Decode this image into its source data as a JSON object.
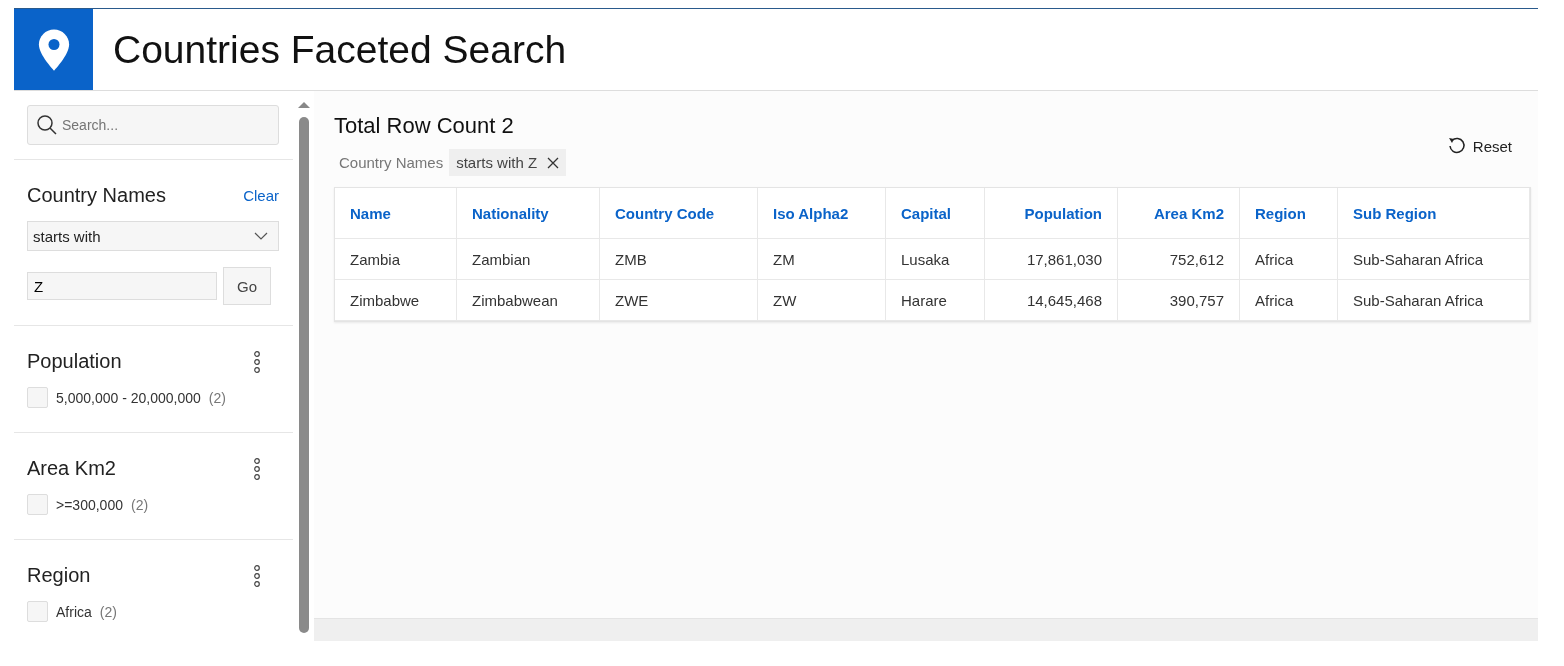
{
  "header": {
    "title": "Countries Faceted Search"
  },
  "sidebar": {
    "search": {
      "placeholder": "Search..."
    },
    "text_facet": {
      "title": "Country Names",
      "clear": "Clear",
      "operator": "starts with",
      "value": "Z",
      "go": "Go"
    },
    "facets": [
      {
        "title": "Population",
        "options": [
          {
            "label": "5,000,000 - 20,000,000",
            "count": "(2)",
            "checked": false
          }
        ]
      },
      {
        "title": "Area Km2",
        "options": [
          {
            "label": ">=300,000",
            "count": "(2)",
            "checked": false
          }
        ]
      },
      {
        "title": "Region",
        "options": [
          {
            "label": "Africa",
            "count": "(2)",
            "checked": false
          }
        ]
      }
    ]
  },
  "results": {
    "total": "Total Row Count 2",
    "reset": "Reset",
    "filters": [
      {
        "facet": "Country Names",
        "value": "starts with Z"
      }
    ],
    "table": {
      "columns": [
        {
          "label": "Name",
          "kind": "text"
        },
        {
          "label": "Nationality",
          "kind": "text"
        },
        {
          "label": "Country Code",
          "kind": "text"
        },
        {
          "label": "Iso Alpha2",
          "kind": "text"
        },
        {
          "label": "Capital",
          "kind": "text"
        },
        {
          "label": "Population",
          "kind": "number"
        },
        {
          "label": "Area Km2",
          "kind": "number"
        },
        {
          "label": "Region",
          "kind": "text"
        },
        {
          "label": "Sub Region",
          "kind": "text"
        }
      ],
      "rows": [
        [
          "Zambia",
          "Zambian",
          "ZMB",
          "ZM",
          "Lusaka",
          "17,861,030",
          "752,612",
          "Africa",
          "Sub-Saharan Africa"
        ],
        [
          "Zimbabwe",
          "Zimbabwean",
          "ZWE",
          "ZW",
          "Harare",
          "14,645,468",
          "390,757",
          "Africa",
          "Sub-Saharan Africa"
        ]
      ]
    }
  }
}
